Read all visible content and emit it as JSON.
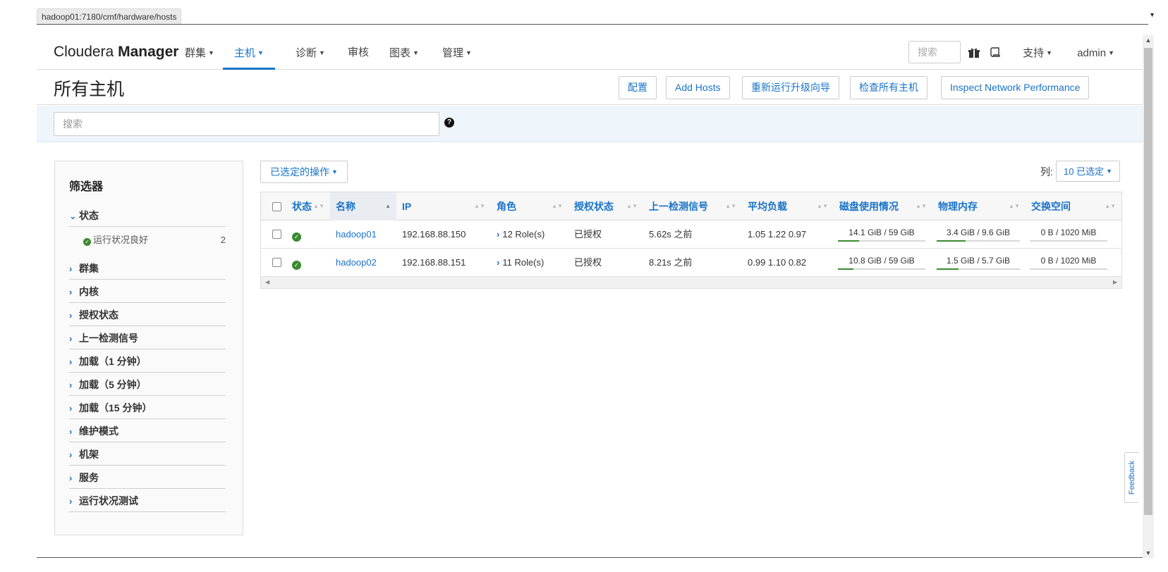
{
  "status_url": "hadoop01:7180/cmf/hardware/hosts",
  "navbar": {
    "brand_light": "Cloudera",
    "brand_bold": "Manager",
    "items": [
      {
        "label": "群集"
      },
      {
        "label": "主机"
      },
      {
        "label": "诊断"
      },
      {
        "label": "审核"
      },
      {
        "label": "图表"
      },
      {
        "label": "管理"
      }
    ],
    "search_placeholder": "搜索",
    "support_label": "支持",
    "user_label": "admin"
  },
  "page": {
    "title": "所有主机",
    "buttons": {
      "config": "配置",
      "add_hosts": "Add Hosts",
      "rerun_wizard": "重新运行升级向导",
      "inspect_all": "检查所有主机",
      "inspect_network": "Inspect Network Performance"
    },
    "search_placeholder": "搜索",
    "help_icon": "?"
  },
  "filters": {
    "title": "筛选器",
    "groups": [
      {
        "label": "状态"
      },
      {
        "label": "群集"
      },
      {
        "label": "内核"
      },
      {
        "label": "授权状态"
      },
      {
        "label": "上一检测信号"
      },
      {
        "label": "加载（1 分钟）"
      },
      {
        "label": "加载（5 分钟）"
      },
      {
        "label": "加载（15 分钟）"
      },
      {
        "label": "维护模式"
      },
      {
        "label": "机架"
      },
      {
        "label": "服务"
      },
      {
        "label": "运行状况测试"
      }
    ],
    "status_option": {
      "label": "运行状况良好",
      "count": "2"
    }
  },
  "table": {
    "actions_label": "已选定的操作",
    "columns_label": "列:",
    "columns_selected": "10 已选定",
    "headers": {
      "status": "状态",
      "name": "名称",
      "ip": "IP",
      "roles": "角色",
      "auth": "授权状态",
      "heartbeat": "上一检测信号",
      "load": "平均负载",
      "disk": "磁盘使用情况",
      "memory": "物理内存",
      "swap": "交换空间"
    },
    "rows": [
      {
        "name": "hadoop01",
        "ip": "192.168.88.150",
        "roles": "12 Role(s)",
        "auth": "已授权",
        "heartbeat": "5.62s 之前",
        "load": "1.05  1.22  0.97",
        "disk": "14.1 GiB / 59 GiB",
        "disk_fraction": 0.24,
        "memory": "3.4 GiB / 9.6 GiB",
        "memory_fraction": 0.35,
        "swap": "0 B / 1020 MiB",
        "swap_fraction": 0.0
      },
      {
        "name": "hadoop02",
        "ip": "192.168.88.151",
        "roles": "11 Role(s)",
        "auth": "已授权",
        "heartbeat": "8.21s 之前",
        "load": "0.99  1.10  0.82",
        "disk": "10.8 GiB / 59 GiB",
        "disk_fraction": 0.18,
        "memory": "1.5 GiB / 5.7 GiB",
        "memory_fraction": 0.26,
        "swap": "0 B / 1020 MiB",
        "swap_fraction": 0.0
      }
    ]
  },
  "feedback_label": "Feedback",
  "colors": {
    "accent": "#1a73c8",
    "good": "#3a8a2e"
  }
}
